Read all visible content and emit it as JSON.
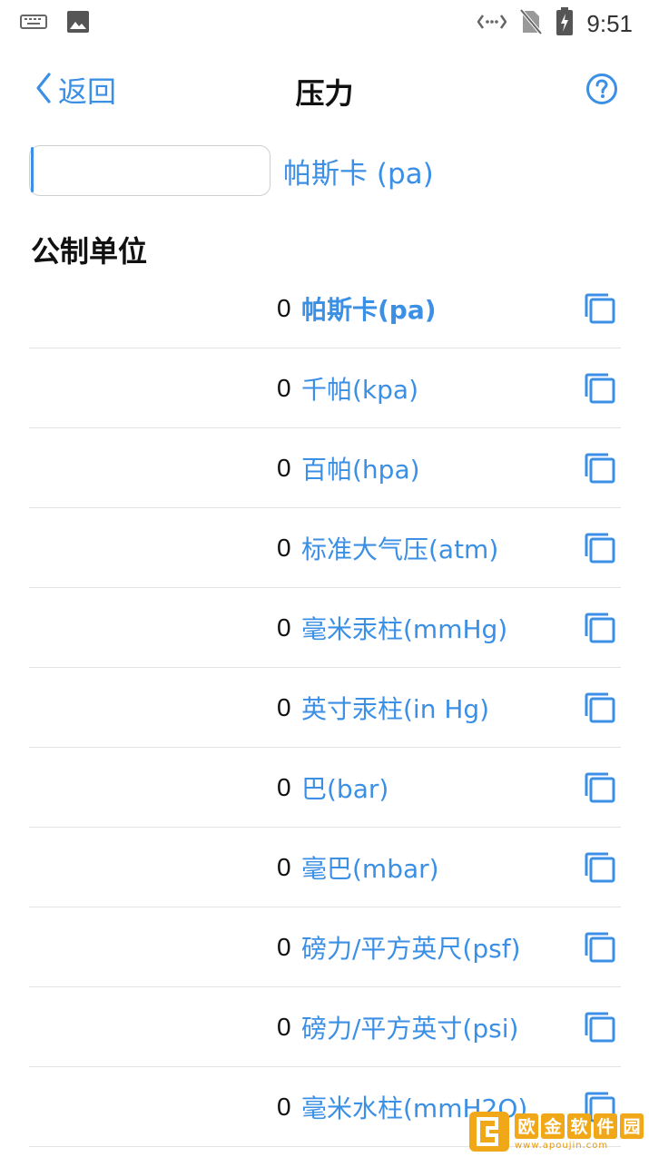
{
  "status_bar": {
    "time": "9:51",
    "icons": [
      "keyboard-icon",
      "image-icon",
      "data-sync-icon",
      "no-sim-icon",
      "battery-charging-icon"
    ]
  },
  "nav": {
    "back_label": "返回",
    "title": "压力",
    "help_icon": "help-circle-icon"
  },
  "input": {
    "value": "",
    "unit_label": "帕斯卡 (pa)"
  },
  "section": {
    "title": "公制单位"
  },
  "units": [
    {
      "value": "0",
      "label": "帕斯卡(pa)",
      "active": true
    },
    {
      "value": "0",
      "label": "千帕(kpa)"
    },
    {
      "value": "0",
      "label": "百帕(hpa)"
    },
    {
      "value": "0",
      "label": "标准大气压(atm)"
    },
    {
      "value": "0",
      "label": "毫米汞柱(mmHg)"
    },
    {
      "value": "0",
      "label": "英寸汞柱(in Hg)"
    },
    {
      "value": "0",
      "label": "巴(bar)"
    },
    {
      "value": "0",
      "label": "毫巴(mbar)"
    },
    {
      "value": "0",
      "label": "磅力/平方英尺(psf)"
    },
    {
      "value": "0",
      "label": "磅力/平方英寸(psi)"
    },
    {
      "value": "0",
      "label": "毫米水柱(mmH2O)"
    }
  ],
  "watermark": {
    "chars": [
      "欧",
      "金",
      "软",
      "件",
      "园"
    ],
    "url": "www.apoujin.com"
  },
  "colors": {
    "accent": "#3b8fe4",
    "divider": "#e3e3e3",
    "watermark": "#f0a818"
  }
}
